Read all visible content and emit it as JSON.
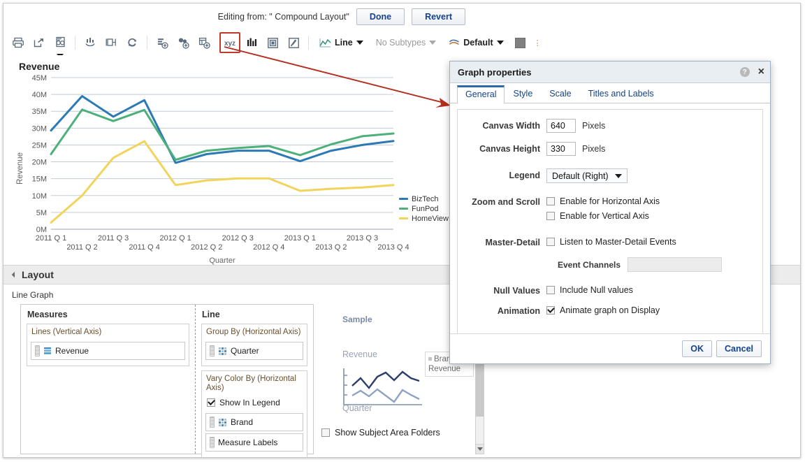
{
  "editbar": {
    "editing_from": "Editing from: \" Compound Layout\"",
    "done_label": "Done",
    "revert_label": "Revert"
  },
  "toolbar": {
    "icons": [
      {
        "name": "print-icon",
        "glyph": "print"
      },
      {
        "name": "export-icon",
        "glyph": "export"
      },
      {
        "name": "preview-report-icon",
        "glyph": "preview"
      },
      {
        "name": "edit-formula-icon",
        "glyph": "formula"
      },
      {
        "name": "rename-view-icon",
        "glyph": "rename"
      },
      {
        "name": "refresh-icon",
        "glyph": "refresh"
      },
      {
        "name": "add-measure-icon",
        "glyph": "add-measure"
      },
      {
        "name": "add-group-icon",
        "glyph": "add-group"
      },
      {
        "name": "add-calculated-item-icon",
        "glyph": "add-calc"
      },
      {
        "name": "graph-properties-icon",
        "glyph": "xyz"
      },
      {
        "name": "axis-scale-icon",
        "glyph": "bars"
      },
      {
        "name": "page-layout-icon",
        "glyph": "page"
      },
      {
        "name": "style-icon",
        "glyph": "style"
      }
    ],
    "graph_type": "Line",
    "subtypes": "No Subtypes",
    "style": "Default"
  },
  "chart_data": {
    "type": "line",
    "title": "Revenue",
    "xlabel": "Quarter",
    "ylabel": "Revenue",
    "ylim": [
      0,
      45000000
    ],
    "ytick_labels": [
      "0M",
      "5M",
      "10M",
      "15M",
      "20M",
      "25M",
      "30M",
      "35M",
      "40M",
      "45M"
    ],
    "grid": true,
    "legend_position": "right",
    "categories": [
      "2011 Q 1",
      "2011 Q 2",
      "2011 Q 3",
      "2011 Q 4",
      "2012 Q 1",
      "2012 Q 2",
      "2012 Q 3",
      "2012 Q 4",
      "2013 Q 1",
      "2013 Q 2",
      "2013 Q 3",
      "2013 Q 4"
    ],
    "series": [
      {
        "name": "BizTech",
        "color": "#2b7ab5",
        "values": [
          29.3,
          39.5,
          33.4,
          38.3,
          19.7,
          22.3,
          23.3,
          23.3,
          20.2,
          23.3,
          25.0,
          26.2
        ]
      },
      {
        "name": "FunPod",
        "color": "#4cb07a",
        "values": [
          22.3,
          35.5,
          32.1,
          35.4,
          20.6,
          23.3,
          24.1,
          24.7,
          22.0,
          25.2,
          27.6,
          28.4
        ]
      },
      {
        "name": "HomeView",
        "color": "#f2d35c",
        "values": [
          2.0,
          10.0,
          21.2,
          26.1,
          13.1,
          14.5,
          15.1,
          15.1,
          11.4,
          12.0,
          12.4,
          13.1
        ]
      }
    ],
    "value_unit": "M"
  },
  "layout_panel": {
    "header": "Layout",
    "graph_kind": "Line Graph",
    "columns": [
      {
        "title": "Measures",
        "zones": [
          {
            "title": "Lines (Vertical Axis)",
            "checkbox": null,
            "chips": [
              {
                "label": "Revenue",
                "icon": "measure-icon"
              }
            ]
          }
        ]
      },
      {
        "title": "Line",
        "zones": [
          {
            "title": "Group By (Horizontal Axis)",
            "checkbox": null,
            "chips": [
              {
                "label": "Quarter",
                "icon": "dimension-icon"
              }
            ]
          },
          {
            "title": "Vary Color By (Horizontal Axis)",
            "checkbox": {
              "label": "Show In Legend",
              "checked": true
            },
            "chips": [
              {
                "label": "Brand",
                "icon": "dimension-icon"
              },
              {
                "label": "Measure Labels",
                "icon": "none"
              }
            ]
          }
        ]
      }
    ],
    "sample": {
      "title": "Sample",
      "y_label": "Revenue",
      "x_label": "Quarter",
      "legend_text": "Brand, Revenue"
    },
    "show_subject_area_folders": {
      "label": "Show Subject Area Folders",
      "checked": false
    }
  },
  "dialog": {
    "title": "Graph properties",
    "help_glyph": "?",
    "close_glyph": "×",
    "tabs": [
      {
        "label": "General",
        "active": true
      },
      {
        "label": "Style",
        "active": false
      },
      {
        "label": "Scale",
        "active": false
      },
      {
        "label": "Titles and Labels",
        "active": false
      }
    ],
    "fields": {
      "canvas_width": {
        "label": "Canvas Width",
        "value": "640",
        "units": "Pixels"
      },
      "canvas_height": {
        "label": "Canvas Height",
        "value": "330",
        "units": "Pixels"
      },
      "legend": {
        "label": "Legend",
        "value": "Default (Right)"
      },
      "zoom_and_scroll": {
        "label": "Zoom and Scroll",
        "options": [
          {
            "label": "Enable for Horizontal Axis",
            "checked": false
          },
          {
            "label": "Enable for Vertical Axis",
            "checked": false
          }
        ]
      },
      "master_detail": {
        "label": "Master-Detail",
        "options": [
          {
            "label": "Listen to Master-Detail Events",
            "checked": false
          }
        ],
        "event_channels_label": "Event Channels",
        "event_channels_value": ""
      },
      "null_values": {
        "label": "Null Values",
        "options": [
          {
            "label": "Include Null values",
            "checked": false
          }
        ]
      },
      "animation": {
        "label": "Animation",
        "options": [
          {
            "label": "Animate graph on Display",
            "checked": true
          }
        ]
      }
    },
    "ok_label": "OK",
    "cancel_label": "Cancel"
  },
  "colors": {
    "accent": "#15428b",
    "annotation": "#b42f20",
    "highlight_border": "#c0392b"
  }
}
